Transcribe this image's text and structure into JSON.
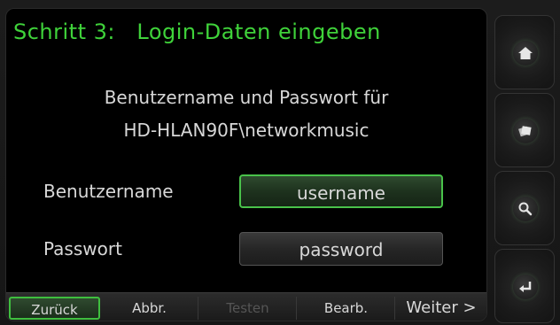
{
  "title": "Schritt 3:   Login-Daten eingeben",
  "prompt": {
    "line1": "Benutzername und Passwort für",
    "line2": "HD-HLAN90F\\networkmusic"
  },
  "fields": {
    "username_label": "Benutzername",
    "username_value": "username",
    "password_label": "Passwort",
    "password_value": "password"
  },
  "bottom_bar": {
    "back": "Zurück",
    "abort": "Abbr.",
    "test": "Testen",
    "edit": "Bearb.",
    "next": "Weiter >"
  },
  "side_buttons": [
    {
      "icon": "home-icon"
    },
    {
      "icon": "browse-icon"
    },
    {
      "icon": "search-icon"
    },
    {
      "icon": "enter-icon"
    }
  ],
  "colors": {
    "accent": "#3fd23a",
    "background": "#000000",
    "text": "#d8d8d8",
    "disabled": "#555555"
  }
}
